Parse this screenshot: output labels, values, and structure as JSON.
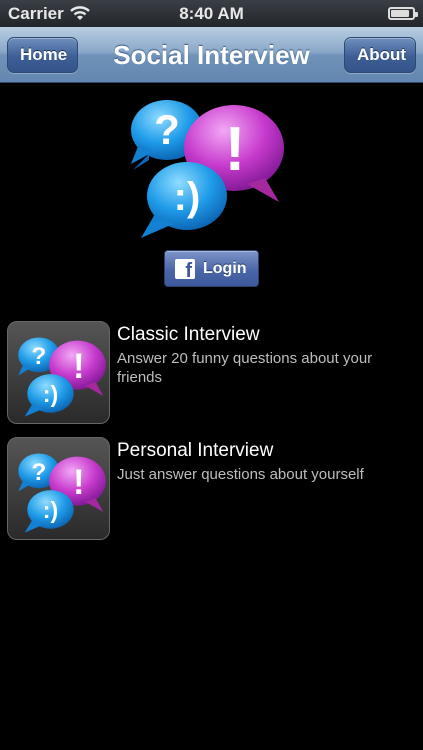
{
  "status_bar": {
    "carrier": "Carrier",
    "time": "8:40 AM",
    "battery_level": 0.85
  },
  "nav": {
    "title": "Social Interview",
    "home_label": "Home",
    "about_label": "About"
  },
  "logo": {
    "question_glyph": "?",
    "exclamation_glyph": "!",
    "smiley_glyph": ":)"
  },
  "login": {
    "icon_glyph": "f",
    "label": "Login"
  },
  "interviews": [
    {
      "title": "Classic Interview",
      "description": "Answer 20 funny questions about your friends"
    },
    {
      "title": "Personal Interview",
      "description": "Just answer questions about yourself"
    }
  ],
  "colors": {
    "blue_bubble": "#1e9be8",
    "pink_bubble": "#c63acc",
    "nav_blue": "#6f92b8"
  }
}
